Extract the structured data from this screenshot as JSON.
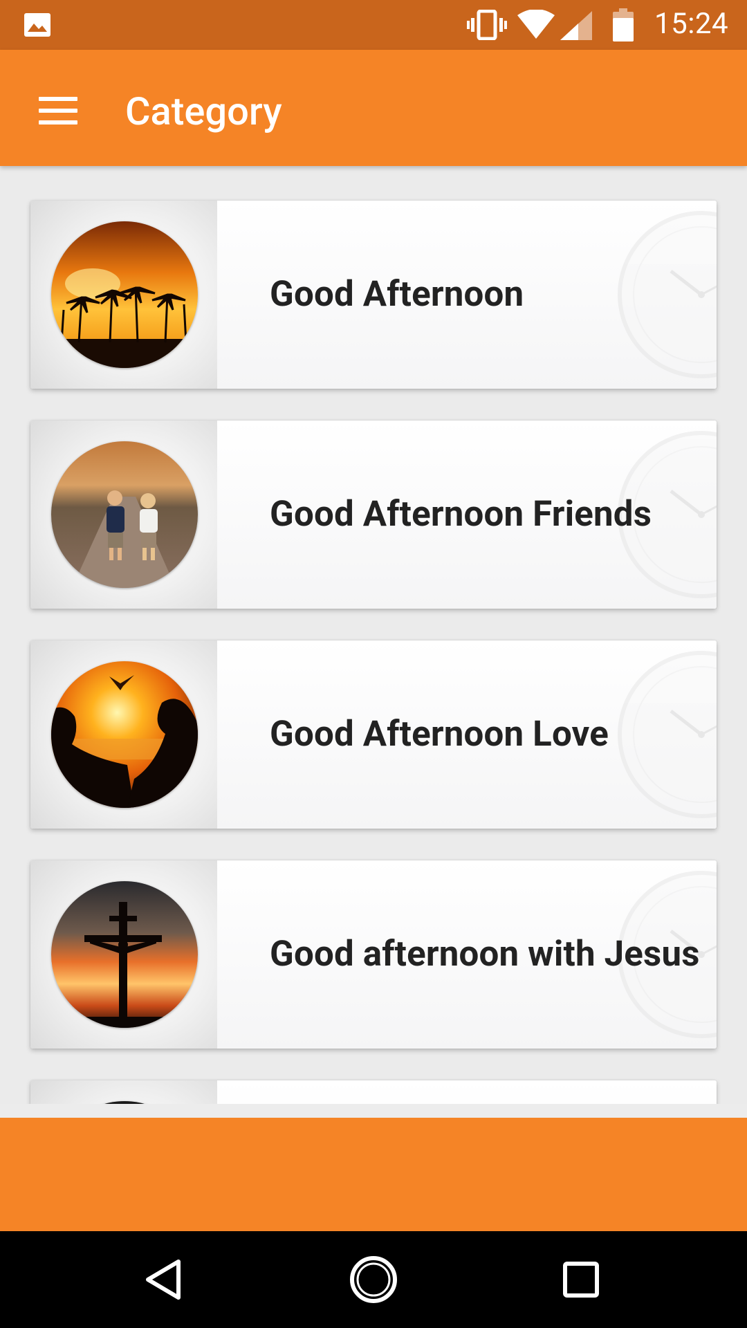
{
  "status_bar": {
    "time": "15:24",
    "icons": [
      "gallery-icon",
      "vibrate-icon",
      "wifi-icon",
      "signal-icon",
      "battery-icon"
    ]
  },
  "app_bar": {
    "title": "Category",
    "menu_icon": "menu-icon"
  },
  "categories": [
    {
      "label": "Good Afternoon",
      "image": "palm-sunset"
    },
    {
      "label": "Good Afternoon Friends",
      "image": "children-road"
    },
    {
      "label": "Good Afternoon Love",
      "image": "couple-sunset"
    },
    {
      "label": "Good afternoon with Jesus",
      "image": "cross-sunset"
    }
  ],
  "nav_bar": {
    "icons": [
      "back-icon",
      "home-icon",
      "recents-icon"
    ]
  },
  "colors": {
    "status_bar": "#c9651c",
    "primary": "#f58426",
    "background": "#ebebeb",
    "text": "#222222"
  }
}
